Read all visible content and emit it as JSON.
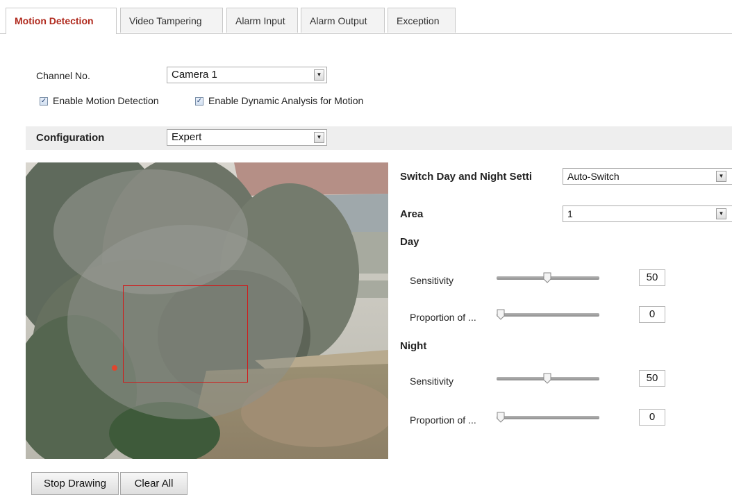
{
  "tabs": [
    "Motion Detection",
    "Video Tampering",
    "Alarm Input",
    "Alarm Output",
    "Exception"
  ],
  "channel": {
    "label": "Channel No.",
    "value": "Camera 1"
  },
  "checkboxes": {
    "enable_motion": {
      "label": "Enable Motion Detection",
      "checked": true
    },
    "enable_dynamic": {
      "label": "Enable Dynamic Analysis for Motion",
      "checked": true
    }
  },
  "configuration": {
    "label": "Configuration",
    "value": "Expert"
  },
  "switch_day_night": {
    "label": "Switch Day and Night Setti",
    "value": "Auto-Switch"
  },
  "area": {
    "label": "Area",
    "value": "1"
  },
  "day": {
    "title": "Day",
    "sensitivity_label": "Sensitivity",
    "sensitivity_value": "50",
    "proportion_label": "Proportion of ...",
    "proportion_value": "0"
  },
  "night": {
    "title": "Night",
    "sensitivity_label": "Sensitivity",
    "sensitivity_value": "50",
    "proportion_label": "Proportion of ...",
    "proportion_value": "0"
  },
  "buttons": {
    "stop_drawing": "Stop Drawing",
    "clear_all": "Clear All"
  },
  "colors": {
    "active_tab": "#b02a1e",
    "roi_border": "#d11a1a"
  }
}
